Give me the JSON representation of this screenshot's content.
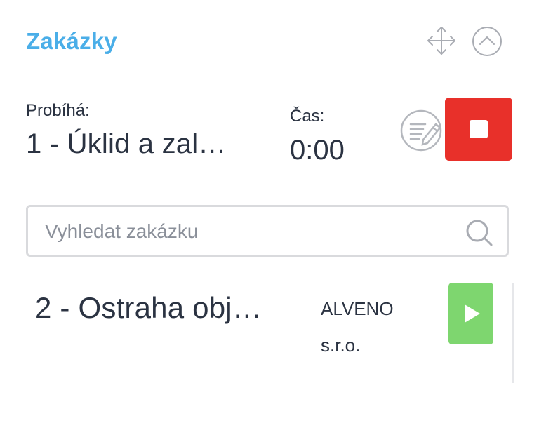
{
  "header": {
    "title": "Zakázky",
    "move_icon": "move-arrows-icon",
    "collapse_icon": "chevron-up-circle-icon"
  },
  "running": {
    "label": "Probíhá:",
    "job": "1 - Úklid a zal…",
    "time_label": "Čas:",
    "time_value": "0:00",
    "note_icon": "edit-note-icon",
    "stop_icon": "stop-icon"
  },
  "search": {
    "placeholder": "Vyhledat zakázku",
    "value": "",
    "icon": "search-icon"
  },
  "jobs": [
    {
      "name": "2 - Ostraha obj…",
      "client_line1": "ALVENO",
      "client_line2": "s.r.o.",
      "action_icon": "play-icon"
    }
  ],
  "colors": {
    "accent": "#4aaee8",
    "stop": "#e8302a",
    "play": "#7ed66f",
    "text": "#2b3342",
    "border": "#d9dadd"
  }
}
